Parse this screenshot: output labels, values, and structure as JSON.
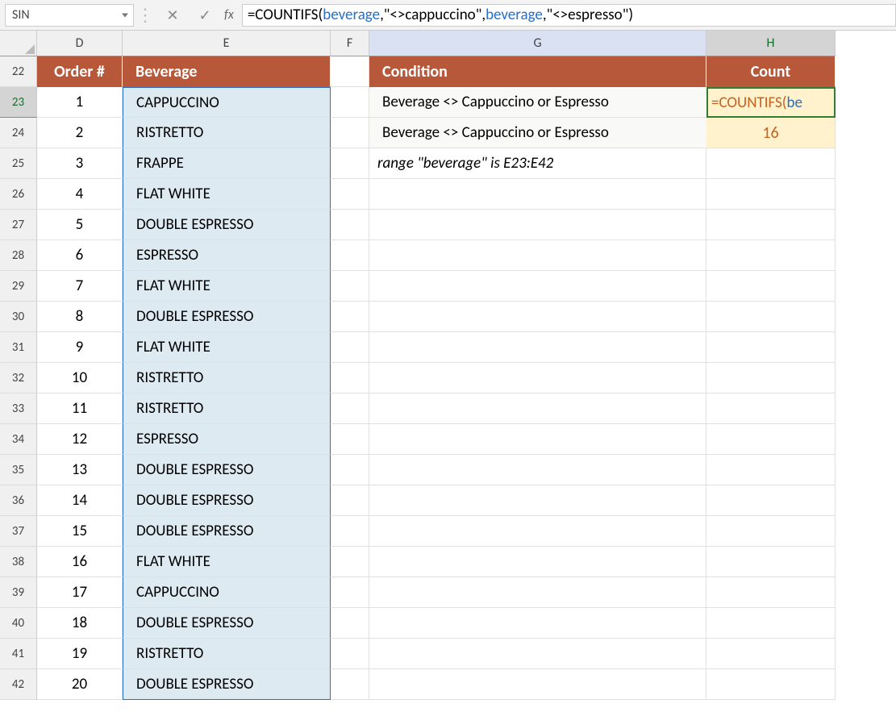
{
  "nameBox": "SIN",
  "formulaBar": {
    "prefix": "=COUNTIFS(",
    "range1": "beverage",
    "mid1": ",\"<>cappuccino\",",
    "range2": "beverage",
    "suffix": ",\"<>espresso\")"
  },
  "columns": [
    "D",
    "E",
    "F",
    "G",
    "H"
  ],
  "rowStart": 22,
  "rowEnd": 42,
  "headers": {
    "D": "Order #",
    "E": "Beverage",
    "G": "Condition",
    "H": "Count"
  },
  "orders": [
    {
      "n": "1",
      "b": "CAPPUCCINO"
    },
    {
      "n": "2",
      "b": "RISTRETTO"
    },
    {
      "n": "3",
      "b": "FRAPPE"
    },
    {
      "n": "4",
      "b": "FLAT WHITE"
    },
    {
      "n": "5",
      "b": "DOUBLE ESPRESSO"
    },
    {
      "n": "6",
      "b": "ESPRESSO"
    },
    {
      "n": "7",
      "b": "FLAT WHITE"
    },
    {
      "n": "8",
      "b": "DOUBLE ESPRESSO"
    },
    {
      "n": "9",
      "b": "FLAT WHITE"
    },
    {
      "n": "10",
      "b": "RISTRETTO"
    },
    {
      "n": "11",
      "b": "RISTRETTO"
    },
    {
      "n": "12",
      "b": "ESPRESSO"
    },
    {
      "n": "13",
      "b": "DOUBLE ESPRESSO"
    },
    {
      "n": "14",
      "b": "DOUBLE ESPRESSO"
    },
    {
      "n": "15",
      "b": "DOUBLE ESPRESSO"
    },
    {
      "n": "16",
      "b": "FLAT WHITE"
    },
    {
      "n": "17",
      "b": "CAPPUCCINO"
    },
    {
      "n": "18",
      "b": "DOUBLE ESPRESSO"
    },
    {
      "n": "19",
      "b": "RISTRETTO"
    },
    {
      "n": "20",
      "b": "DOUBLE ESPRESSO"
    }
  ],
  "gCells": {
    "23": "Beverage <> Cappuccino or Espresso",
    "24": "Beverage <> Cappuccino or Espresso",
    "25": "range \"beverage\" is E23:E42"
  },
  "hCells": {
    "23_formula_prefix": "=COUNTIFS(",
    "23_formula_rng": "be",
    "24": "16"
  }
}
